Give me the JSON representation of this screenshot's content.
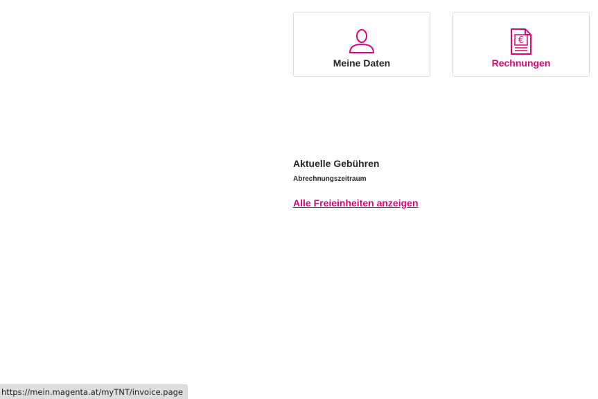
{
  "cards": [
    {
      "label": "Meine Daten",
      "icon": "user-icon"
    },
    {
      "label": "Rechnungen",
      "icon": "invoice-euro-icon"
    }
  ],
  "charges": {
    "title": "Aktuelle Gebühren",
    "subtitle": "Abrechnungszeitraum",
    "link": "Alle Freieinheiten anzeigen"
  },
  "status_bar": {
    "url": "https://mein.magenta.at/myTNT/invoice.page"
  },
  "colors": {
    "accent": "#e20074",
    "text": "#262626",
    "card_border": "#dcdcdc",
    "status_bg": "#dedede"
  }
}
